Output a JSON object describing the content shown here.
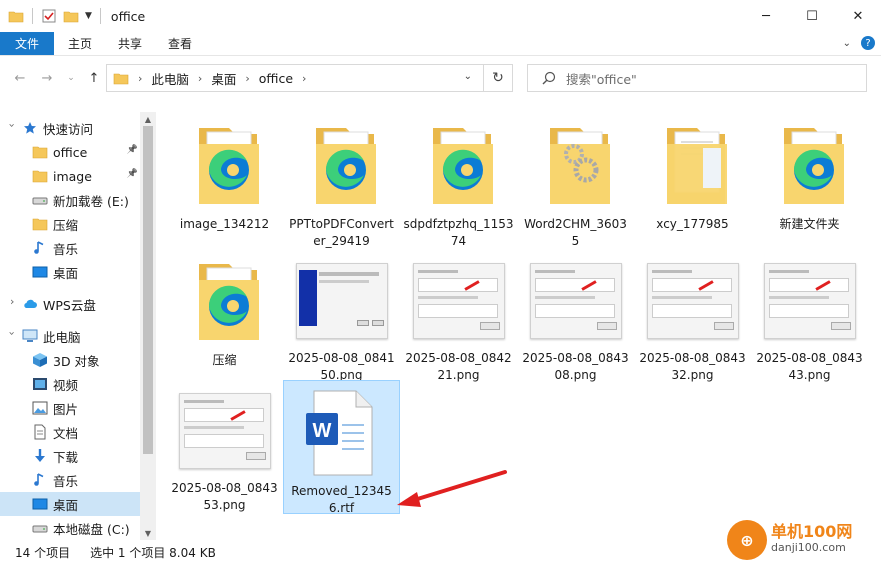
{
  "window": {
    "title": "office",
    "minimize": "─",
    "maximize": "☐",
    "close": "✕"
  },
  "ribbon": {
    "tabs": [
      "文件",
      "主页",
      "共享",
      "查看"
    ]
  },
  "address": {
    "crumbs": [
      "此电脑",
      "桌面",
      "office"
    ],
    "search_placeholder": "搜索\"office\""
  },
  "sidebar": {
    "items": [
      {
        "label": "快速访问",
        "icon": "star-icon"
      },
      {
        "label": "office",
        "icon": "folder-icon",
        "pinned": true
      },
      {
        "label": "image",
        "icon": "folder-icon",
        "pinned": true
      },
      {
        "label": "新加载卷 (E:)",
        "icon": "drive-icon"
      },
      {
        "label": "压缩",
        "icon": "folder-icon"
      },
      {
        "label": "音乐",
        "icon": "music-icon"
      },
      {
        "label": "桌面",
        "icon": "desktop-icon"
      },
      {
        "label": "WPS云盘",
        "icon": "cloud-icon"
      },
      {
        "label": "此电脑",
        "icon": "computer-icon"
      },
      {
        "label": "3D 对象",
        "icon": "cube-icon"
      },
      {
        "label": "视频",
        "icon": "video-icon"
      },
      {
        "label": "图片",
        "icon": "picture-icon"
      },
      {
        "label": "文档",
        "icon": "document-icon"
      },
      {
        "label": "下载",
        "icon": "download-icon"
      },
      {
        "label": "音乐",
        "icon": "music-icon"
      },
      {
        "label": "桌面",
        "icon": "desktop-icon",
        "selected": true
      },
      {
        "label": "本地磁盘 (C:)",
        "icon": "drive-icon"
      }
    ]
  },
  "files": [
    {
      "name": "image_134212",
      "type": "edge-folder"
    },
    {
      "name": "PPTtoPDFConverter_29419",
      "type": "edge-folder"
    },
    {
      "name": "sdpdfztpzhq_115374",
      "type": "edge-folder"
    },
    {
      "name": "Word2CHM_36035",
      "type": "gear-folder"
    },
    {
      "name": "xcy_177985",
      "type": "doc-folder"
    },
    {
      "name": "新建文件夹",
      "type": "edge-folder"
    },
    {
      "name": "压缩",
      "type": "edge-folder"
    },
    {
      "name": "2025-08-08_084150.png",
      "type": "screenshot-blue"
    },
    {
      "name": "2025-08-08_084221.png",
      "type": "screenshot"
    },
    {
      "name": "2025-08-08_084308.png",
      "type": "screenshot"
    },
    {
      "name": "2025-08-08_084332.png",
      "type": "screenshot"
    },
    {
      "name": "2025-08-08_084343.png",
      "type": "screenshot"
    },
    {
      "name": "2025-08-08_084353.png",
      "type": "screenshot"
    },
    {
      "name": "Removed_123456.rtf",
      "type": "word",
      "selected": true
    }
  ],
  "status": {
    "count": "14 个项目",
    "selection": "选中 1 个项目  8.04 KB"
  },
  "watermark": {
    "title": "单机100网",
    "url": "danji100.com"
  },
  "colors": {
    "accent": "#1979ca",
    "selection": "#cce8ff",
    "folder": "#f5c75a",
    "arrow": "#e02020"
  }
}
